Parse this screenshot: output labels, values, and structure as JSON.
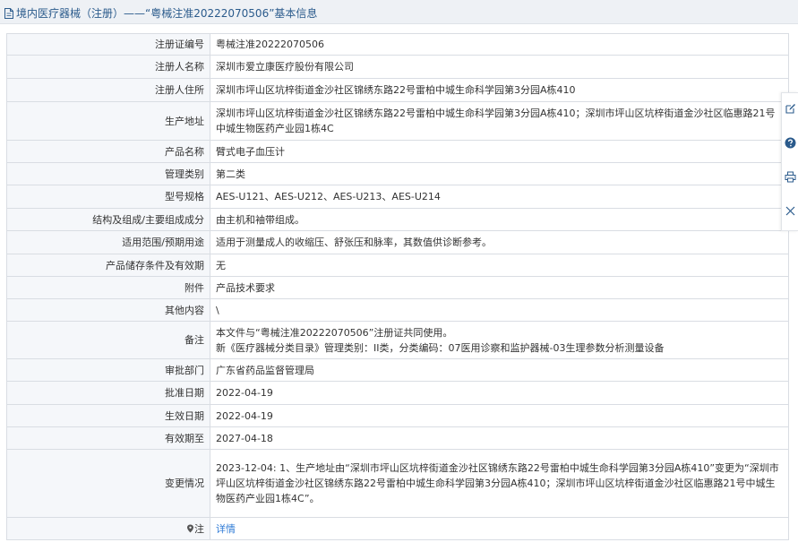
{
  "header": {
    "title": "境内医疗器械（注册）——“粤械注准20222070506”基本信息"
  },
  "rows": [
    {
      "label": "注册证编号",
      "value": "粤械注准20222070506"
    },
    {
      "label": "注册人名称",
      "value": "深圳市爱立康医疗股份有限公司"
    },
    {
      "label": "注册人住所",
      "value": "深圳市坪山区坑梓街道金沙社区锦绣东路22号雷柏中城生命科学园第3分园A栋410"
    },
    {
      "label": "生产地址",
      "value": "深圳市坪山区坑梓街道金沙社区锦绣东路22号雷柏中城生命科学园第3分园A栋410；深圳市坪山区坑梓街道金沙社区临惠路21号中城生物医药产业园1栋4C"
    },
    {
      "label": "产品名称",
      "value": "臂式电子血压计"
    },
    {
      "label": "管理类别",
      "value": "第二类"
    },
    {
      "label": "型号规格",
      "value": "AES-U121、AES-U212、AES-U213、AES-U214"
    },
    {
      "label": "结构及组成/主要组成成分",
      "value": "由主机和袖带组成。"
    },
    {
      "label": "适用范围/预期用途",
      "value": "适用于测量成人的收缩压、舒张压和脉率，其数值供诊断参考。"
    },
    {
      "label": "产品储存条件及有效期",
      "value": "无"
    },
    {
      "label": "附件",
      "value": "产品技术要求"
    },
    {
      "label": "其他内容",
      "value": "\\"
    },
    {
      "label": "备注",
      "value_line1": "本文件与“粤械注准20222070506”注册证共同使用。",
      "value_line2": "新《医疗器械分类目录》管理类别：II类，分类编码：07医用诊察和监护器械-03生理参数分析测量设备"
    },
    {
      "label": "审批部门",
      "value": "广东省药品监督管理局"
    },
    {
      "label": "批准日期",
      "value": "2022-04-19"
    },
    {
      "label": "生效日期",
      "value": "2022-04-19"
    },
    {
      "label": "有效期至",
      "value": "2027-04-18"
    },
    {
      "label": "变更情况",
      "value": "2023-12-04: 1、生产地址由“深圳市坪山区坑梓街道金沙社区锦绣东路22号雷柏中城生命科学园第3分园A栋410”变更为“深圳市坪山区坑梓街道金沙社区锦绣东路22号雷柏中城生命科学园第3分园A栋410；深圳市坪山区坑梓街道金沙社区临惠路21号中城生物医药产业园1栋4C”。"
    },
    {
      "label": "注",
      "value": "详情"
    }
  ],
  "toolbar": {
    "icons": [
      "edit-icon",
      "help-icon",
      "print-icon",
      "close-icon"
    ]
  },
  "colors": {
    "link": "#2f7bd6",
    "title": "#2b5b8c",
    "label_bg": "#f5f7fa",
    "border": "#d9dde3"
  }
}
